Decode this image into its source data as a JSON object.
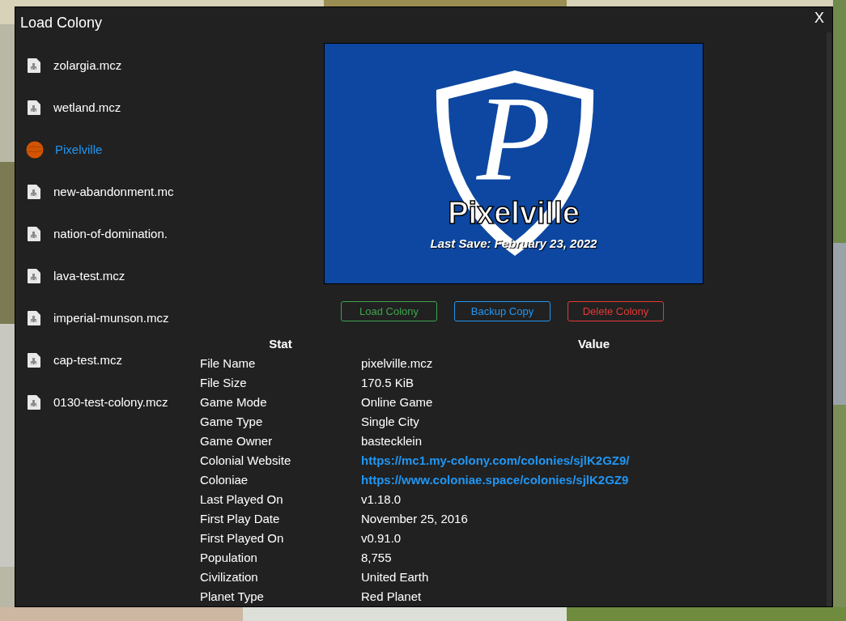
{
  "window": {
    "title": "Load Colony",
    "close": "X"
  },
  "colonies": [
    {
      "name": "zolargia.mcz",
      "kind": "file",
      "selected": false
    },
    {
      "name": "wetland.mcz",
      "kind": "file",
      "selected": false
    },
    {
      "name": "Pixelville",
      "kind": "planet",
      "selected": true
    },
    {
      "name": "new-abandonment.mc",
      "kind": "file",
      "selected": false
    },
    {
      "name": "nation-of-domination.",
      "kind": "file",
      "selected": false
    },
    {
      "name": "lava-test.mcz",
      "kind": "file",
      "selected": false
    },
    {
      "name": "imperial-munson.mcz",
      "kind": "file",
      "selected": false
    },
    {
      "name": "cap-test.mcz",
      "kind": "file",
      "selected": false
    },
    {
      "name": "0130-test-colony.mcz",
      "kind": "file",
      "selected": false
    }
  ],
  "banner": {
    "logo_letter": "P",
    "title": "Pixelville",
    "subtitle": "Last Save: February 23, 2022"
  },
  "buttons": [
    {
      "label": "Load Colony",
      "kind": "load"
    },
    {
      "label": "Backup Copy",
      "kind": "backup"
    },
    {
      "label": "Delete Colony",
      "kind": "delete"
    }
  ],
  "table": {
    "columns": [
      "Stat",
      "Value"
    ],
    "rows": [
      {
        "stat": "File Name",
        "value": "pixelville.mcz",
        "kind": "text"
      },
      {
        "stat": "File Size",
        "value": "170.5 KiB",
        "kind": "text"
      },
      {
        "stat": "Game Mode",
        "value": "Online Game",
        "kind": "text"
      },
      {
        "stat": "Game Type",
        "value": "Single City",
        "kind": "text"
      },
      {
        "stat": "Game Owner",
        "value": "bastecklein",
        "kind": "text"
      },
      {
        "stat": "Colonial Website",
        "value": "https://mc1.my-colony.com/colonies/sjlK2GZ9/",
        "kind": "link"
      },
      {
        "stat": "Coloniae",
        "value": "https://www.coloniae.space/colonies/sjlK2GZ9",
        "kind": "link"
      },
      {
        "stat": "Last Played On",
        "value": "v1.18.0",
        "kind": "text"
      },
      {
        "stat": "First Play Date",
        "value": "November 25, 2016",
        "kind": "text"
      },
      {
        "stat": "First Played On",
        "value": "v0.91.0",
        "kind": "text"
      },
      {
        "stat": "Population",
        "value": "8,755",
        "kind": "text"
      },
      {
        "stat": "Civilization",
        "value": "United Earth",
        "kind": "text"
      },
      {
        "stat": "Planet Type",
        "value": "Red Planet",
        "kind": "text"
      }
    ]
  }
}
